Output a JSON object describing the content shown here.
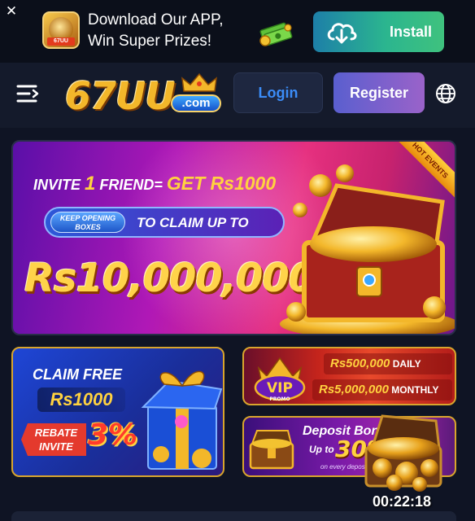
{
  "app_bar": {
    "close_label": "✕",
    "promo_line1": "Download Our APP,",
    "promo_line2": "Win Super Prizes!",
    "install_label": "Install"
  },
  "header": {
    "brand": "67UU",
    "brand_suffix": ".com",
    "login_label": "Login",
    "register_label": "Register"
  },
  "hero_banner": {
    "ribbon": "HOT EVENTS",
    "invite_text": "INVITE ",
    "invite_count": "1",
    "invite_friend": " FRIEND= ",
    "get_text": "GET Rs1000",
    "badge_text": "KEEP OPENING BOXES",
    "claim_text": "TO CLAIM UP TO",
    "amount": "Rs10,000,000"
  },
  "promo_claim": {
    "title": "CLAIM FREE",
    "amount": "Rs1000",
    "rebate_line1": "REBATE",
    "rebate_line2": "INVITE",
    "percent": "3%"
  },
  "promo_vip": {
    "badge": "VIP",
    "badge_sub": "PROMO",
    "daily_amount": "Rs500,000",
    "daily_label": " DAILY",
    "monthly_amount": "Rs5,000,000",
    "monthly_label": " MONTHLY"
  },
  "promo_deposit": {
    "title": "Deposit Bonu",
    "up_to": "Up to",
    "percent": "30%",
    "note": "on every deposit"
  },
  "floating_widget": {
    "timer": "00:22:18"
  },
  "icons": {
    "close": "close-icon",
    "menu": "menu-icon",
    "globe": "globe-icon",
    "install": "cloud-download-icon"
  },
  "colors": {
    "background": "#0f1424",
    "install_gradient_start": "#1d7fa8",
    "install_gradient_end": "#3fc27e",
    "login_text": "#3b8cf7",
    "register_gradient_start": "#5a5fcf",
    "register_gradient_end": "#9a62c9",
    "gold": "#ffd23f"
  }
}
